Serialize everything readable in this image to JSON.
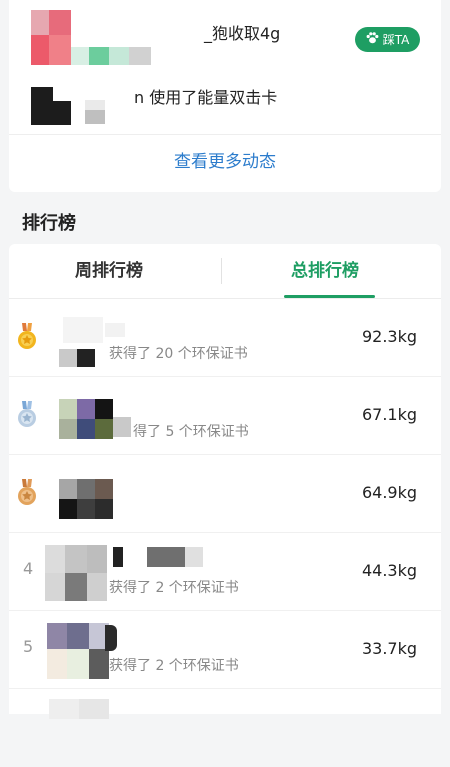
{
  "feed": {
    "items": [
      {
        "text": "_狍收取4g"
      },
      {
        "text": "n 使用了能量双击卡"
      }
    ],
    "ta_button": {
      "icon": "paw-icon",
      "label": "踩TA"
    },
    "more_label": "查看更多动态"
  },
  "leaderboard": {
    "title": "排行榜",
    "tabs": [
      {
        "label": "周排行榜",
        "active": false
      },
      {
        "label": "总排行榜",
        "active": true
      }
    ],
    "rows": [
      {
        "rank": "1",
        "badge": "gold-medal-icon",
        "subtitle": "获得了 20 个环保证书",
        "weight": "92.3kg"
      },
      {
        "rank": "2",
        "badge": "silver-medal-icon",
        "subtitle": "得了 5 个环保证书",
        "weight": "67.1kg"
      },
      {
        "rank": "3",
        "badge": "bronze-medal-icon",
        "subtitle": "",
        "weight": "64.9kg"
      },
      {
        "rank": "4",
        "badge": "",
        "subtitle": "获得了 2 个环保证书",
        "weight": "44.3kg"
      },
      {
        "rank": "5",
        "badge": "",
        "subtitle": "获得了 2 个环保证书",
        "weight": "33.7kg"
      }
    ]
  },
  "colors": {
    "brand_green": "#1e9e63",
    "link_blue": "#2c7ccc"
  }
}
